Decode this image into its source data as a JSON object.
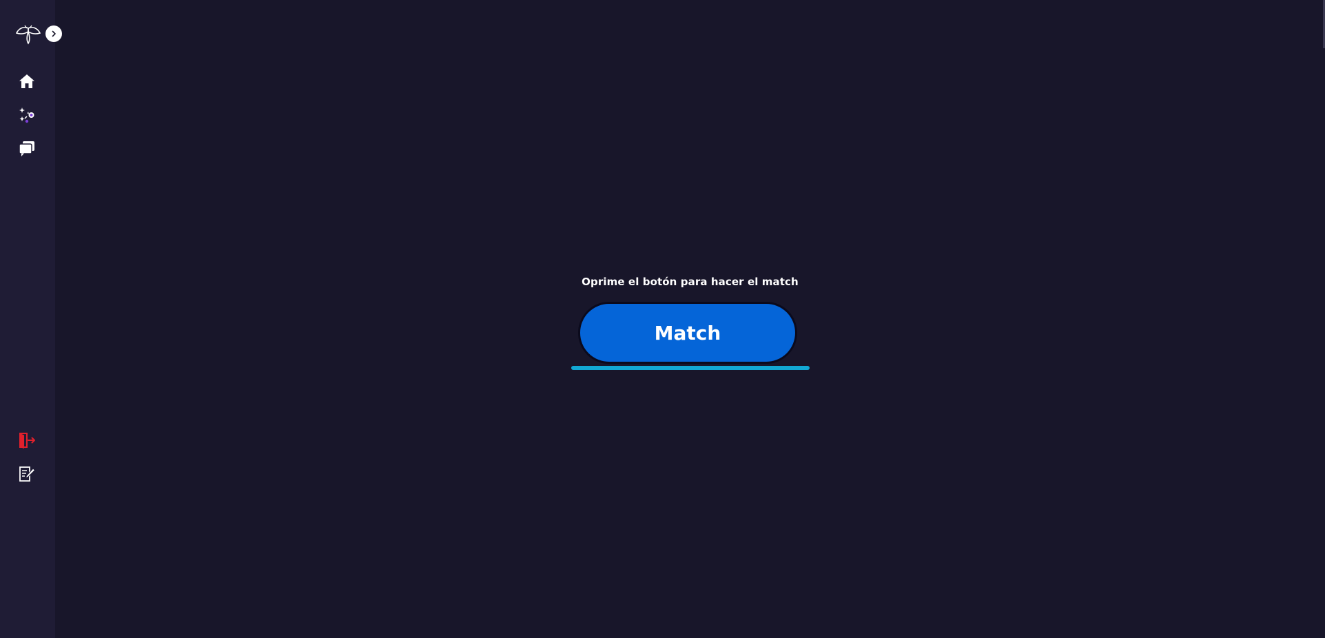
{
  "sidebar": {
    "logo_icon": "firefly-logo-icon",
    "expand_icon": "chevron-right-icon",
    "nav_items": [
      {
        "icon": "home-icon"
      },
      {
        "icon": "match-sparkle-icon"
      },
      {
        "icon": "chat-bubbles-icon"
      }
    ],
    "bottom_items": [
      {
        "icon": "logout-icon",
        "color": "#e0202c"
      },
      {
        "icon": "edit-document-icon"
      }
    ]
  },
  "main": {
    "prompt": "Oprime el botón para hacer el match",
    "match_label": "Match"
  },
  "colors": {
    "background": "#18162a",
    "sidebar": "#1f1c35",
    "button": "#0565d8",
    "underline": "#12a8d4",
    "logout": "#e0202c"
  }
}
